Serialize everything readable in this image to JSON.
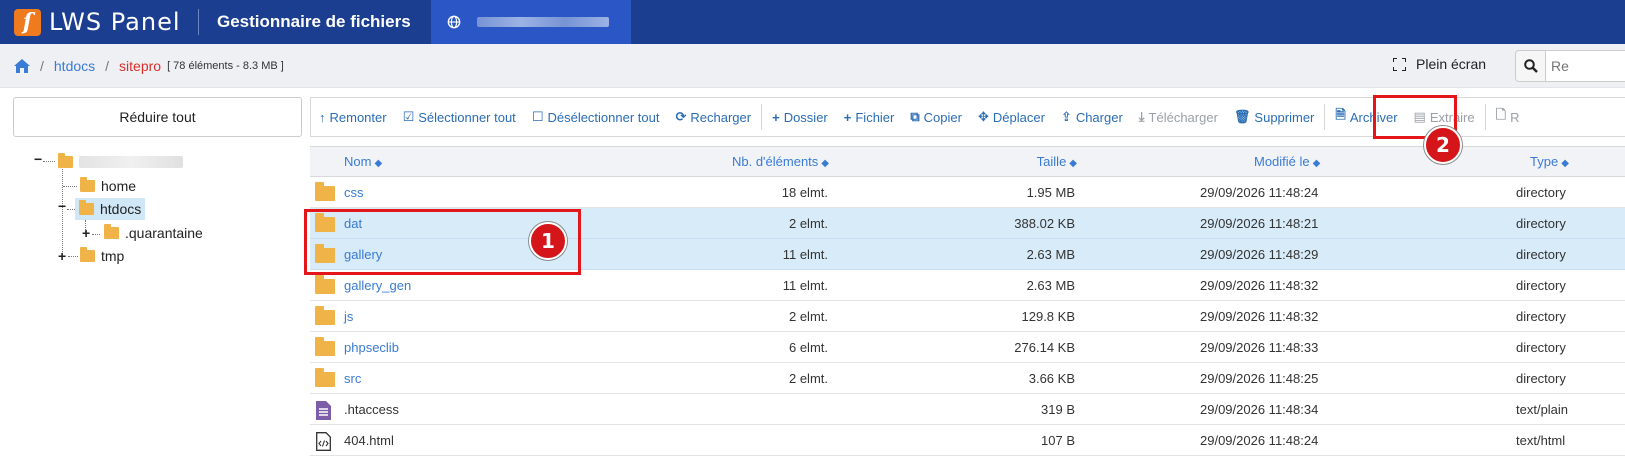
{
  "header": {
    "logo_mark": "ſ",
    "logo_text": "LWS Panel",
    "app_title": "Gestionnaire de fichiers",
    "globe_icon": "globe-icon"
  },
  "breadcrumb": {
    "home_icon": "home-icon",
    "items": [
      "htdocs",
      "sitepro"
    ],
    "info": "[ 78 éléments - 8.3 MB ]"
  },
  "top_actions": {
    "fullscreen_label": "Plein écran",
    "search_placeholder": "Re"
  },
  "left_panel": {
    "collapse_label": "Réduire tout",
    "tree": {
      "children": [
        {
          "label": "home"
        },
        {
          "label": "htdocs",
          "selected": true,
          "children": [
            {
              "label": ".quarantaine"
            }
          ]
        },
        {
          "label": "tmp"
        }
      ]
    }
  },
  "toolbar": [
    {
      "label": "Remonter",
      "icon": "up-arrow-icon",
      "enabled": true
    },
    {
      "label": "Sélectionner tout",
      "icon": "checkbox-checked-icon",
      "enabled": true
    },
    {
      "label": "Désélectionner tout",
      "icon": "checkbox-empty-icon",
      "enabled": true
    },
    {
      "label": "Recharger",
      "icon": "refresh-icon",
      "enabled": true
    },
    {
      "label": "Dossier",
      "icon": "plus-icon",
      "enabled": true
    },
    {
      "label": "Fichier",
      "icon": "plus-icon",
      "enabled": true
    },
    {
      "label": "Copier",
      "icon": "copy-icon",
      "enabled": true
    },
    {
      "label": "Déplacer",
      "icon": "move-icon",
      "enabled": true
    },
    {
      "label": "Charger",
      "icon": "upload-icon",
      "enabled": true
    },
    {
      "label": "Télécharger",
      "icon": "download-icon",
      "enabled": false
    },
    {
      "label": "Supprimer",
      "icon": "trash-icon",
      "enabled": true
    },
    {
      "label": "Archiver",
      "icon": "archive-file-icon",
      "enabled": true
    },
    {
      "label": "Extraire",
      "icon": "extract-icon",
      "enabled": false
    },
    {
      "label": "R",
      "icon": "file-icon",
      "enabled": false
    }
  ],
  "table": {
    "columns": [
      "Nom",
      "Nb. d'éléments",
      "Taille",
      "Modifié le",
      "Type"
    ],
    "rows": [
      {
        "name": "css",
        "kind": "folder",
        "count": "18 elmt.",
        "size": "1.95 MB",
        "modified": "29/09/2026 11:48:24",
        "type": "directory",
        "selected": false
      },
      {
        "name": "dat",
        "kind": "folder",
        "count": "2 elmt.",
        "size": "388.02 KB",
        "modified": "29/09/2026 11:48:21",
        "type": "directory",
        "selected": true
      },
      {
        "name": "gallery",
        "kind": "folder",
        "count": "11 elmt.",
        "size": "2.63 MB",
        "modified": "29/09/2026 11:48:29",
        "type": "directory",
        "selected": true
      },
      {
        "name": "gallery_gen",
        "kind": "folder",
        "count": "11 elmt.",
        "size": "2.63 MB",
        "modified": "29/09/2026 11:48:32",
        "type": "directory",
        "selected": false
      },
      {
        "name": "js",
        "kind": "folder",
        "count": "2 elmt.",
        "size": "129.8 KB",
        "modified": "29/09/2026 11:48:32",
        "type": "directory",
        "selected": false
      },
      {
        "name": "phpseclib",
        "kind": "folder",
        "count": "6 elmt.",
        "size": "276.14 KB",
        "modified": "29/09/2026 11:48:33",
        "type": "directory",
        "selected": false
      },
      {
        "name": "src",
        "kind": "folder",
        "count": "2 elmt.",
        "size": "3.66 KB",
        "modified": "29/09/2026 11:48:25",
        "type": "directory",
        "selected": false
      },
      {
        "name": ".htaccess",
        "kind": "text",
        "count": "",
        "size": "319 B",
        "modified": "29/09/2026 11:48:34",
        "type": "text/plain",
        "selected": false
      },
      {
        "name": "404.html",
        "kind": "code",
        "count": "",
        "size": "107 B",
        "modified": "29/09/2026 11:48:24",
        "type": "text/html",
        "selected": false
      }
    ]
  },
  "annotations": {
    "badge_1": "1",
    "badge_2": "2",
    "color": "#e3161a"
  }
}
